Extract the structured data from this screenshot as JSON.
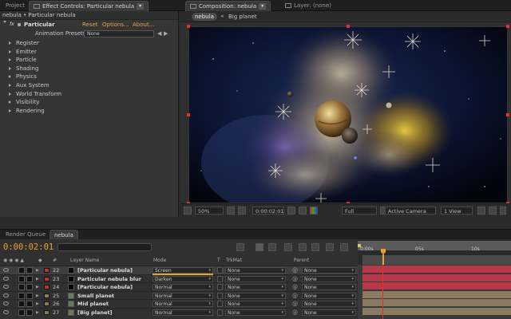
{
  "top_tabs": {
    "project": "Project",
    "effect_controls": "Effect Controls: Particular nebula",
    "composition": "Composition: nebula",
    "layer": "Layer: (none)"
  },
  "effect_controls": {
    "header": "nebula • Particular nebula",
    "fx_badge": "fx",
    "effect_name": "Particular",
    "reset": "Reset",
    "options": "Options...",
    "about": "About...",
    "presets_label": "Animation Presets:",
    "presets_value": "None",
    "groups": [
      "Register",
      "Emitter",
      "Particle",
      "Shading",
      "Physics",
      "Aux System",
      "World Transform",
      "Visibility",
      "Rendering"
    ]
  },
  "composition": {
    "breadcrumbs": [
      "nebula",
      "Big planet"
    ],
    "toolbar": {
      "zoom": "50%",
      "timecode": "0:00:02:01",
      "resolution": "Full",
      "camera": "Active Camera",
      "views": "1 View"
    }
  },
  "timeline": {
    "tabs": [
      "Render Queue",
      "nebula"
    ],
    "timecode": "0:00:02:01",
    "columns": {
      "num": "#",
      "layer_name": "Layer Name",
      "mode": "Mode",
      "t": "T",
      "trkmat": "TrkMat",
      "parent": "Parent"
    },
    "ruler_ticks": [
      "0:00s",
      "05s",
      "10s"
    ],
    "layers": [
      {
        "num": "22",
        "name": "[Particular nebula]",
        "mode": "Screen",
        "trkmat": "None",
        "parent": "None",
        "color": "#c03030"
      },
      {
        "num": "23",
        "name": "Particular nebula blur",
        "mode": "Darken",
        "trkmat": "None",
        "parent": "None",
        "color": "#c03030"
      },
      {
        "num": "24",
        "name": "[Particular nebula]",
        "mode": "Normal",
        "trkmat": "None",
        "parent": "None",
        "color": "#c03030"
      },
      {
        "num": "25",
        "name": "Small planet",
        "mode": "Normal",
        "trkmat": "None",
        "parent": "None",
        "color": "#8a7a60"
      },
      {
        "num": "26",
        "name": "Mid planet",
        "mode": "Normal",
        "trkmat": "None",
        "parent": "None",
        "color": "#8a7a60"
      },
      {
        "num": "27",
        "name": "[Big planet]",
        "mode": "Normal",
        "trkmat": "None",
        "parent": "None",
        "color": "#8a7a60"
      }
    ]
  },
  "colors": {
    "accent_orange": "#e8a030",
    "track_red": "#b8384a",
    "track_tan": "#8a7a60"
  }
}
